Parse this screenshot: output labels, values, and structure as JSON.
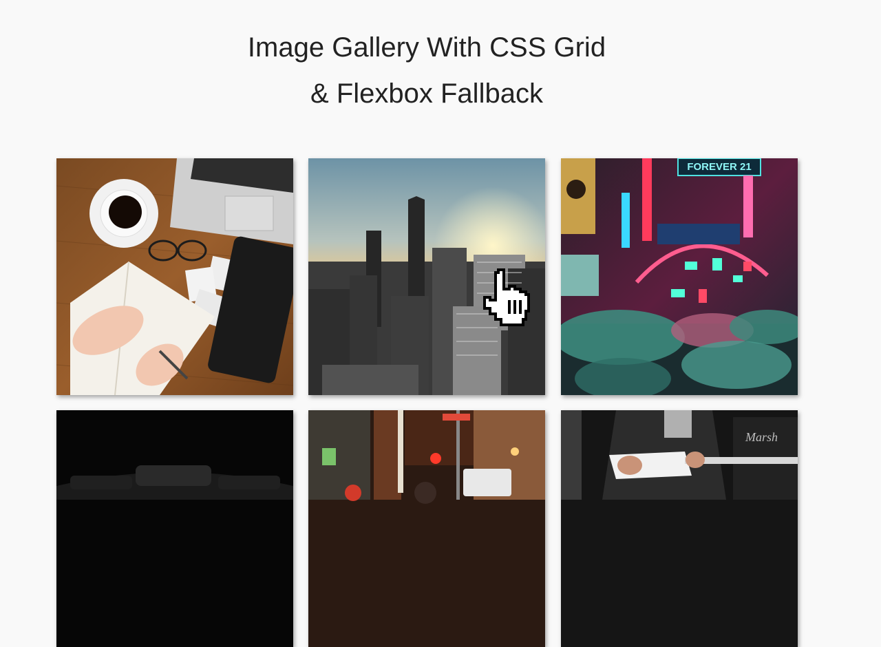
{
  "page": {
    "title_line1": "Image Gallery With CSS Grid",
    "title_line2": "& Flexbox Fallback"
  },
  "gallery": {
    "images": [
      {
        "subject": "desk-workspace",
        "sign_text": ""
      },
      {
        "subject": "city-skyline-sunset",
        "sign_text": ""
      },
      {
        "subject": "neon-street-umbrellas",
        "sign_text": "FOREVER 21"
      },
      {
        "subject": "dark-car-interior",
        "sign_text": ""
      },
      {
        "subject": "night-city-street",
        "sign_text": ""
      },
      {
        "subject": "guitar-player",
        "sign_text": "Marsh"
      }
    ]
  },
  "cursor": {
    "icon": "hand-pointer-icon"
  }
}
